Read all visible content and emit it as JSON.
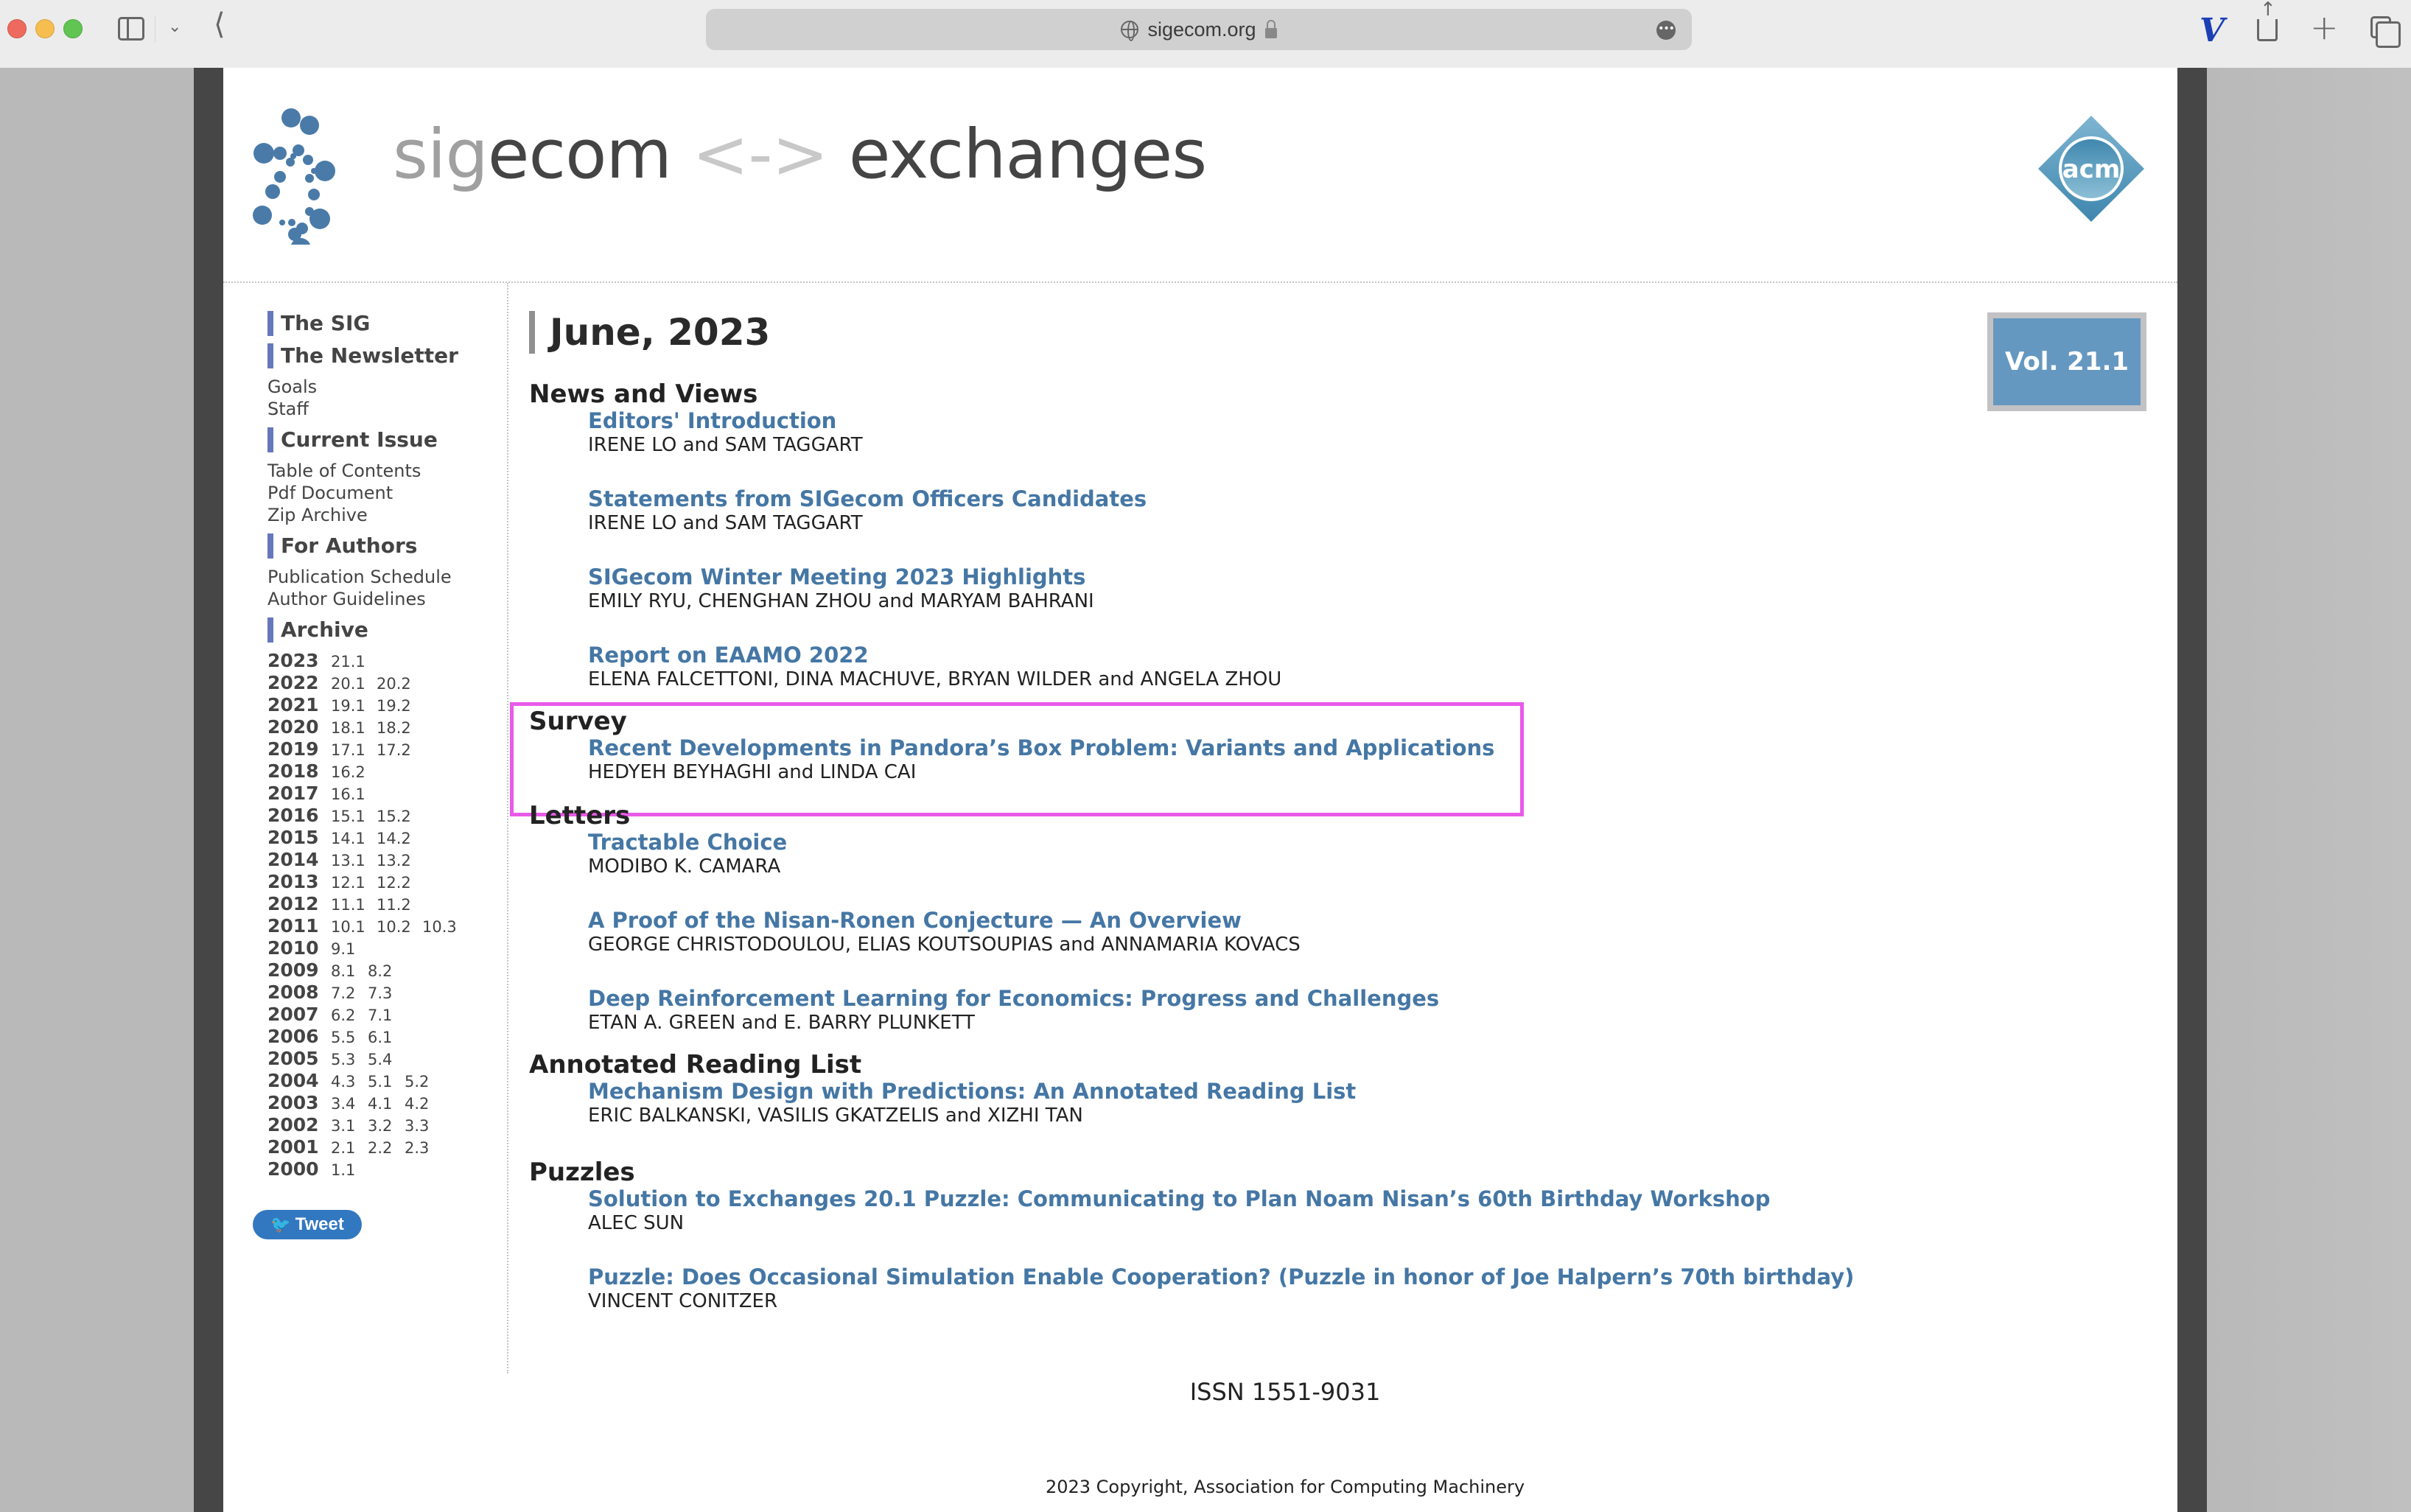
{
  "browser": {
    "url": "sigecom.org",
    "more_label": "•••",
    "extension_label": "V",
    "plus_label": "+"
  },
  "header": {
    "logo_text_sig": "sig",
    "logo_text_ecom": "ecom",
    "logo_text_arrows": " <-> ",
    "logo_text_exchanges": "exchanges",
    "acm_label": "acm",
    "brand_color": "#4577a5"
  },
  "sidebar": {
    "sections": [
      {
        "heading": "The SIG",
        "links": []
      },
      {
        "heading": "The Newsletter",
        "links": [
          "Goals",
          "Staff"
        ]
      },
      {
        "heading": "Current Issue",
        "links": [
          "Table of Contents",
          "Pdf Document",
          "Zip Archive"
        ]
      },
      {
        "heading": "For Authors",
        "links": [
          "Publication Schedule",
          "Author Guidelines"
        ]
      },
      {
        "heading": "Archive",
        "links": []
      }
    ],
    "archive": [
      {
        "year": "2023",
        "volumes": [
          "21.1"
        ]
      },
      {
        "year": "2022",
        "volumes": [
          "20.1",
          "20.2"
        ]
      },
      {
        "year": "2021",
        "volumes": [
          "19.1",
          "19.2"
        ]
      },
      {
        "year": "2020",
        "volumes": [
          "18.1",
          "18.2"
        ]
      },
      {
        "year": "2019",
        "volumes": [
          "17.1",
          "17.2"
        ]
      },
      {
        "year": "2018",
        "volumes": [
          "16.2"
        ]
      },
      {
        "year": "2017",
        "volumes": [
          "16.1"
        ]
      },
      {
        "year": "2016",
        "volumes": [
          "15.1",
          "15.2"
        ]
      },
      {
        "year": "2015",
        "volumes": [
          "14.1",
          "14.2"
        ]
      },
      {
        "year": "2014",
        "volumes": [
          "13.1",
          "13.2"
        ]
      },
      {
        "year": "2013",
        "volumes": [
          "12.1",
          "12.2"
        ]
      },
      {
        "year": "2012",
        "volumes": [
          "11.1",
          "11.2"
        ]
      },
      {
        "year": "2011",
        "volumes": [
          "10.1",
          "10.2",
          "10.3"
        ]
      },
      {
        "year": "2010",
        "volumes": [
          "9.1"
        ]
      },
      {
        "year": "2009",
        "volumes": [
          "8.1",
          "8.2"
        ]
      },
      {
        "year": "2008",
        "volumes": [
          "7.2",
          "7.3"
        ]
      },
      {
        "year": "2007",
        "volumes": [
          "6.2",
          "7.1"
        ]
      },
      {
        "year": "2006",
        "volumes": [
          "5.5",
          "6.1"
        ]
      },
      {
        "year": "2005",
        "volumes": [
          "5.3",
          "5.4"
        ]
      },
      {
        "year": "2004",
        "volumes": [
          "4.3",
          "5.1",
          "5.2"
        ]
      },
      {
        "year": "2003",
        "volumes": [
          "3.4",
          "4.1",
          "4.2"
        ]
      },
      {
        "year": "2002",
        "volumes": [
          "3.1",
          "3.2",
          "3.3"
        ]
      },
      {
        "year": "2001",
        "volumes": [
          "2.1",
          "2.2",
          "2.3"
        ]
      },
      {
        "year": "2000",
        "volumes": [
          "1.1"
        ]
      }
    ],
    "tweet_label": "Tweet"
  },
  "main": {
    "issue_title": "June, 2023",
    "volume_badge": "Vol. 21.1",
    "sections": [
      {
        "title": "News and Views",
        "entries": [
          {
            "title": "Editors' Introduction",
            "authors": "IRENE LO and SAM TAGGART"
          },
          {
            "title": "Statements from SIGecom Officers Candidates",
            "authors": "IRENE LO and SAM TAGGART"
          },
          {
            "title": "SIGecom Winter Meeting 2023 Highlights",
            "authors": "EMILY RYU, CHENGHAN ZHOU and MARYAM BAHRANI"
          },
          {
            "title": "Report on EAAMO 2022",
            "authors": "ELENA FALCETTONI, DINA MACHUVE, BRYAN WILDER and ANGELA ZHOU"
          }
        ]
      },
      {
        "title": "Survey",
        "highlighted": true,
        "entries": [
          {
            "title": "Recent Developments in Pandora’s Box Problem: Variants and Applications",
            "authors": "HEDYEH BEYHAGHI and LINDA CAI"
          }
        ]
      },
      {
        "title": "Letters",
        "entries": [
          {
            "title": "Tractable Choice",
            "authors": "MODIBO K. CAMARA"
          },
          {
            "title": "A Proof of the Nisan-Ronen Conjecture — An Overview",
            "authors": "GEORGE CHRISTODOULOU, ELIAS KOUTSOUPIAS and ANNAMARIA KOVACS"
          },
          {
            "title": "Deep Reinforcement Learning for Economics: Progress and Challenges",
            "authors": "ETAN A. GREEN and E. BARRY PLUNKETT"
          }
        ]
      },
      {
        "title": "Annotated Reading List",
        "entries": [
          {
            "title": "Mechanism Design with Predictions: An Annotated Reading List",
            "authors": "ERIC BALKANSKI, VASILIS GKATZELIS and XIZHI TAN"
          }
        ]
      },
      {
        "title": "Puzzles",
        "entries": [
          {
            "title": "Solution to Exchanges 20.1 Puzzle: Communicating to Plan Noam Nisan’s 60th Birthday Workshop",
            "authors": "ALEC SUN"
          },
          {
            "title": "Puzzle: Does Occasional Simulation Enable Cooperation? (Puzzle in honor of Joe Halpern’s 70th birthday)",
            "authors": "VINCENT CONITZER"
          }
        ]
      }
    ],
    "highlight_color": "#e95ae9"
  },
  "footer": {
    "issn": "ISSN 1551-9031",
    "copyright": "2023 Copyright, Association for Computing Machinery"
  }
}
